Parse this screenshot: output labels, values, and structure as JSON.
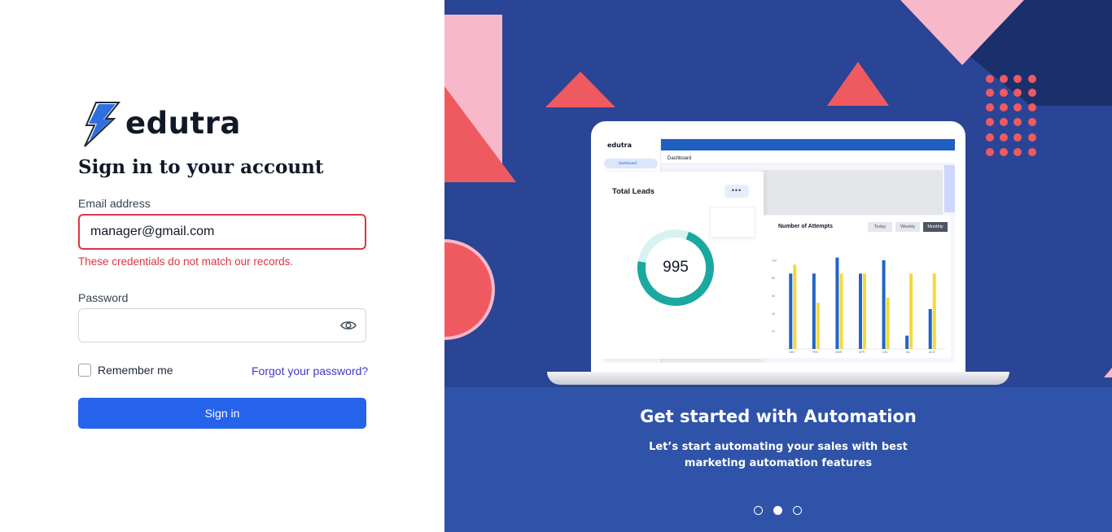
{
  "brand": {
    "name": "edutra"
  },
  "form": {
    "title": "Sign in to your account",
    "email_label": "Email address",
    "email_value": "manager@gmail.com",
    "email_error": "These credentials do not match our records.",
    "password_label": "Password",
    "password_value": "",
    "remember_label": "Remember me",
    "remember_checked": false,
    "forgot_label": "Forgot your password?",
    "submit_label": "Sign in"
  },
  "hero": {
    "title": "Get started with Automation",
    "subtitle_line1": "Let’s start automating your sales with best",
    "subtitle_line2": "marketing automation features",
    "carousel_active": 2,
    "carousel_count": 3
  },
  "mockup": {
    "logo": "edutra",
    "sidebar_item": "Dashboard",
    "page_title": "Dashboard",
    "leads_title": "Total Leads",
    "leads_menu": "•••",
    "leads_value": "995",
    "attempts_title": "Number of Attempts",
    "segments": [
      "Today",
      "Weekly",
      "Monthly"
    ],
    "active_segment": "Monthly",
    "months": [
      "JAN",
      "FEB",
      "MAR",
      "APR",
      "JUN",
      "JUL",
      "AUG"
    ],
    "y_ticks": [
      "100",
      "80",
      "60",
      "40",
      "20"
    ],
    "blue_values": [
      85,
      85,
      103,
      85,
      100,
      15,
      45
    ],
    "yellow_values": [
      95,
      52,
      85,
      85,
      58,
      85,
      85
    ]
  },
  "colors": {
    "primary": "#2563eb",
    "error": "#dc3545",
    "hero_bg": "#2a4596",
    "hero_band": "#2f53a8",
    "accent_red": "#ef5a60",
    "accent_pink": "#f7b8c9",
    "bar_blue": "#1f64c8",
    "bar_yellow": "#f5d938",
    "gauge_teal": "#1aa9a0"
  },
  "icons": {
    "logo": "lightning-bolt-icon",
    "password_toggle": "eye-icon"
  }
}
